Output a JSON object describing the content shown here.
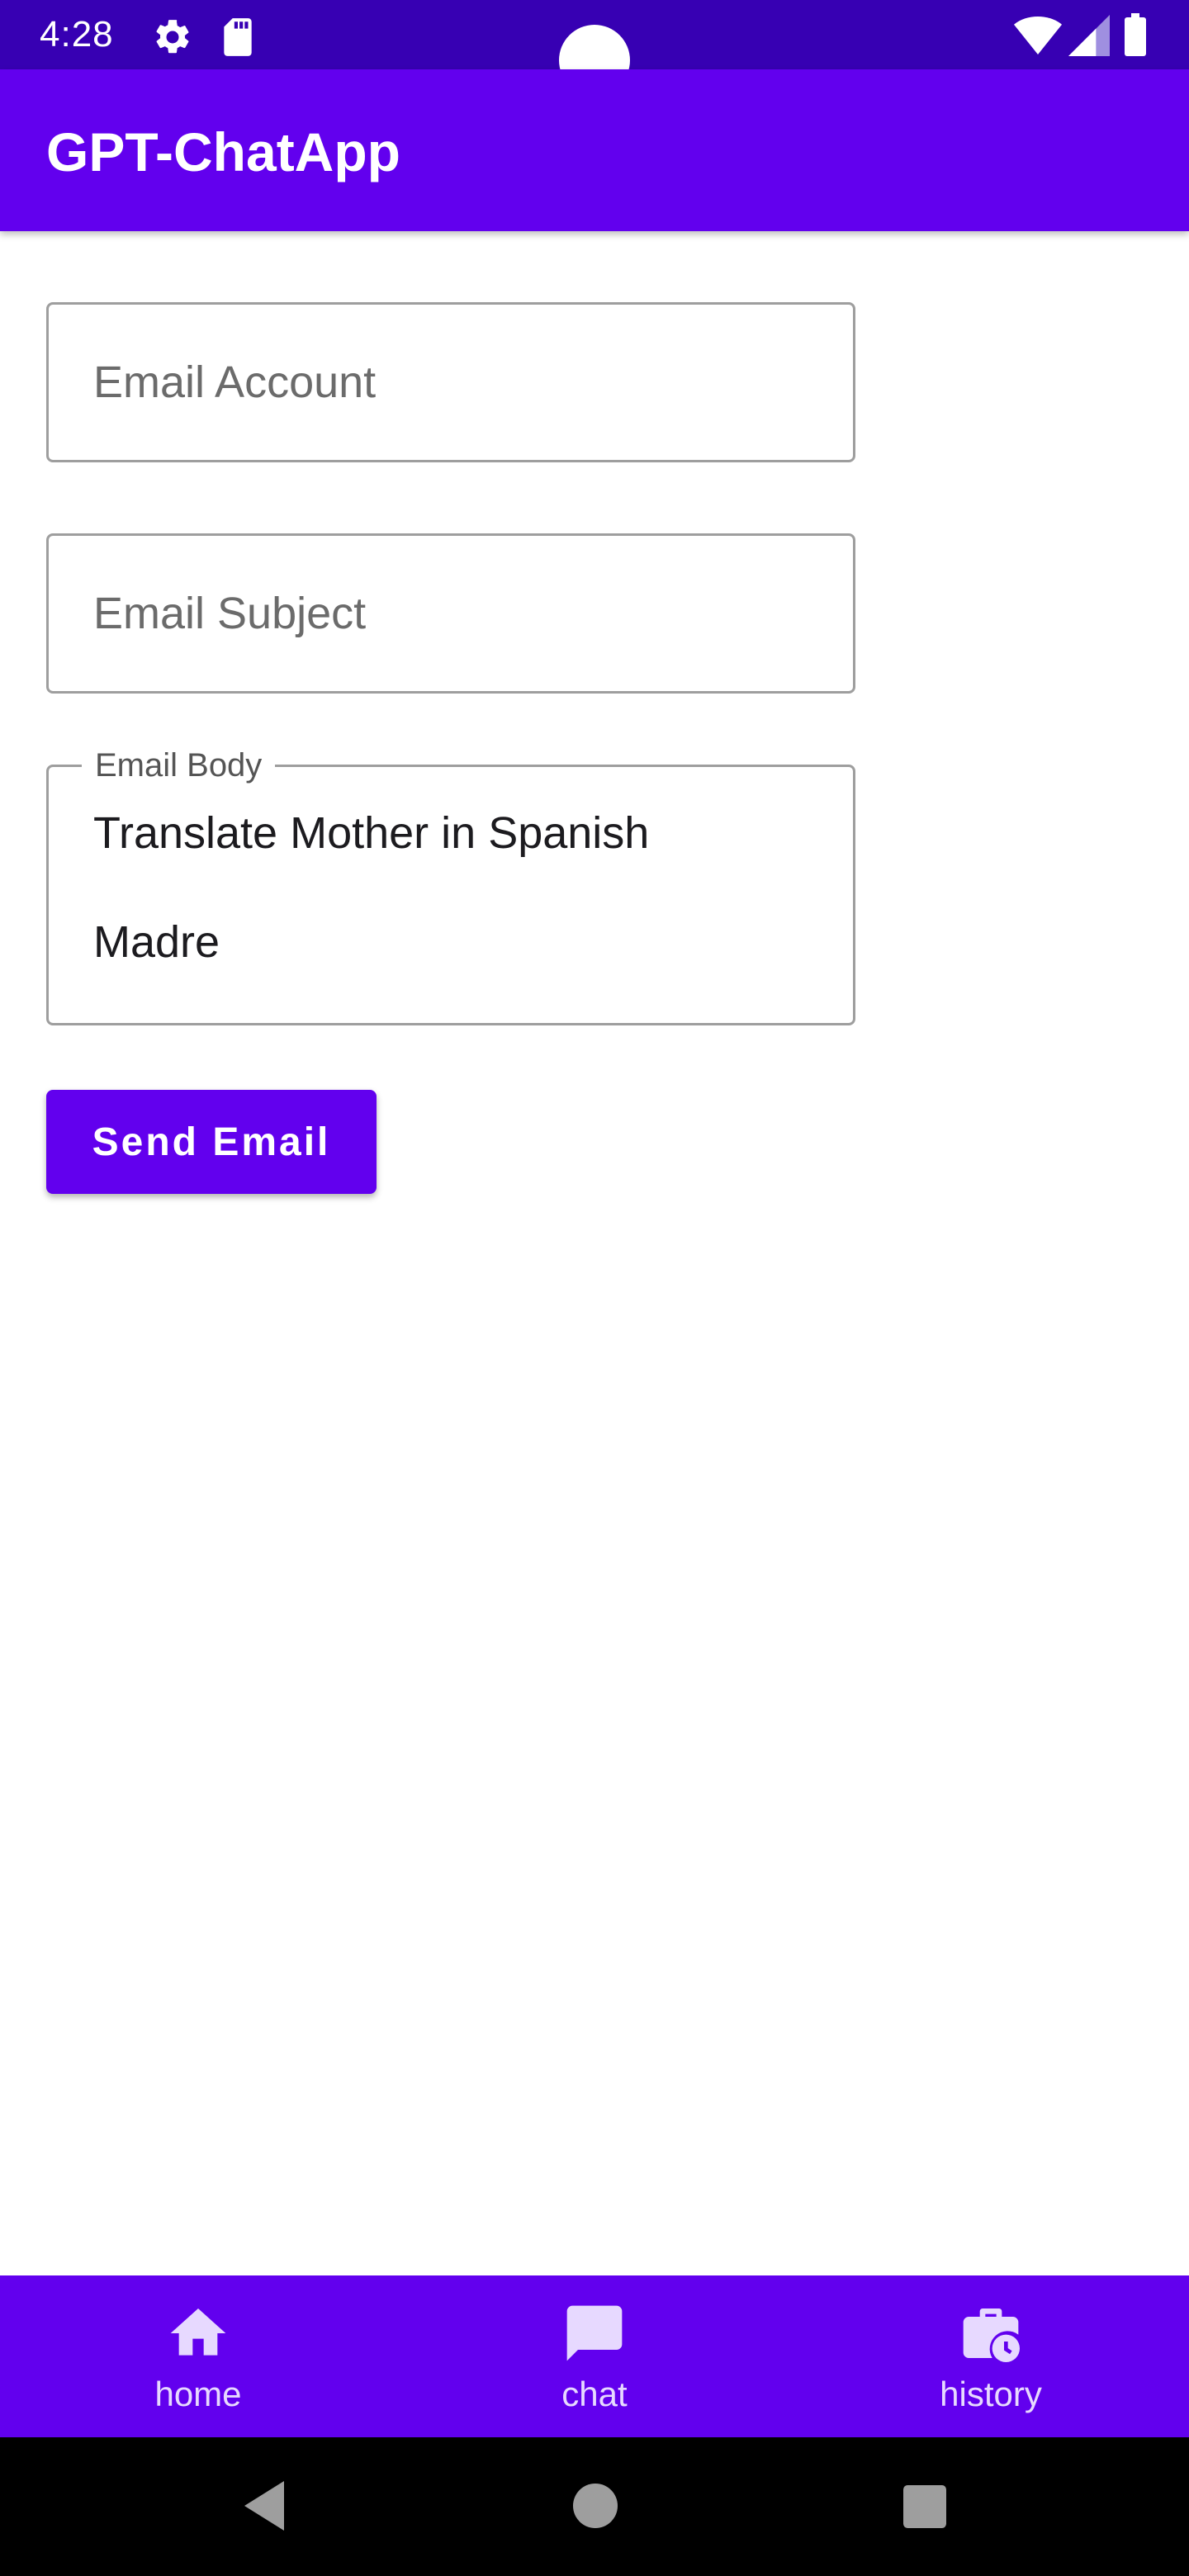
{
  "status_bar": {
    "time": "4:28",
    "icons": [
      "gear-icon",
      "sd-card-icon",
      "wifi-icon",
      "signal-icon",
      "battery-icon"
    ]
  },
  "app_bar": {
    "title": "GPT-ChatApp"
  },
  "form": {
    "account_placeholder": "Email Account",
    "subject_placeholder": "Email Subject",
    "body_label": "Email Body",
    "body_lines": [
      "Translate Mother in Spanish",
      "Madre"
    ],
    "send_label": "Send Email"
  },
  "bottom_nav": {
    "items": [
      {
        "label": "home",
        "icon": "home-icon"
      },
      {
        "label": "chat",
        "icon": "chat-icon"
      },
      {
        "label": "history",
        "icon": "history-icon"
      }
    ]
  },
  "system_nav": {
    "icons": [
      "back-icon",
      "home-circle-icon",
      "recents-icon"
    ]
  },
  "colors": {
    "primary": "#6200ee",
    "primary_dark": "#3700b3",
    "nav_label": "#e7d9ff",
    "outline": "#9e9e9e"
  }
}
